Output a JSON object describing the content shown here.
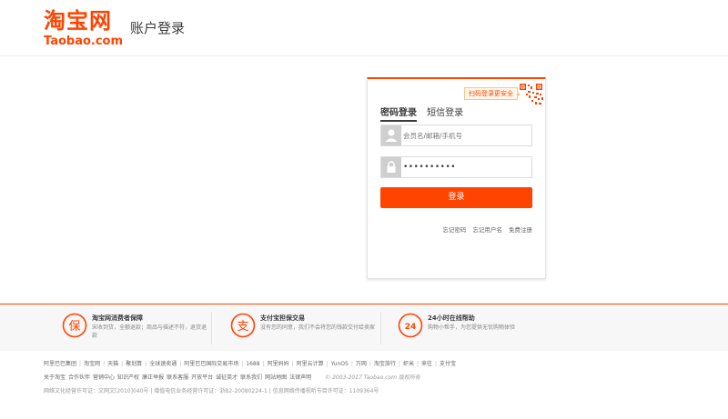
{
  "header": {
    "logo_cn": "淘宝网",
    "logo_en_main": "Taobao",
    "logo_en_tld": ".com",
    "title": "账户登录"
  },
  "login": {
    "qr_tip": "扫码登录更安全",
    "tabs": [
      {
        "label": "密码登录",
        "active": true
      },
      {
        "label": "短信登录",
        "active": false
      }
    ],
    "username_placeholder": "会员名/邮箱/手机号",
    "password_value": "••••••••••",
    "submit_label": "登录",
    "links": [
      "忘记密码",
      "忘记用户名",
      "免费注册"
    ]
  },
  "guarantees": [
    {
      "icon": "bao-icon",
      "glyph": "保",
      "title": "淘宝网消费者保障",
      "desc": "宋收到货，全额退款；商品与描述不符，退货退款"
    },
    {
      "icon": "zhi-icon",
      "glyph": "支",
      "title": "支付宝担保交易",
      "desc": "没有您的同意，我们不会将您的钱款交付给卖家"
    },
    {
      "icon": "24h-icon",
      "glyph": "24",
      "title": "24小时在线帮助",
      "desc": "购物小帮手，为您提供无忧购物体验"
    }
  ],
  "footer": {
    "line1": [
      "阿里巴巴集团",
      "淘宝网",
      "天猫",
      "聚划算",
      "全球速卖通",
      "阿里巴巴国际交易市场",
      "1688",
      "阿里妈妈",
      "阿里云计算",
      "YunOS",
      "万网",
      "淘宝旅行",
      "虾米",
      "来往",
      "支付宝"
    ],
    "line2": [
      "关于淘宝",
      "合作伙伴",
      "营销中心",
      "知识产权",
      "廉正举报",
      "联系客服",
      "开放平台",
      "诚征英才",
      "联系我们",
      "网站地图",
      "法律声明"
    ],
    "copyright": "© 2003-2017 Taobao.com 版权所有",
    "line3": "网络文化经营许可证：文网文[2010]040号 | 增值电信业务经营许可证：浙B2-20080224-1 | 信息网络传播视听节目许可证：1109364号"
  },
  "colors": {
    "brand": "#ff4400"
  }
}
